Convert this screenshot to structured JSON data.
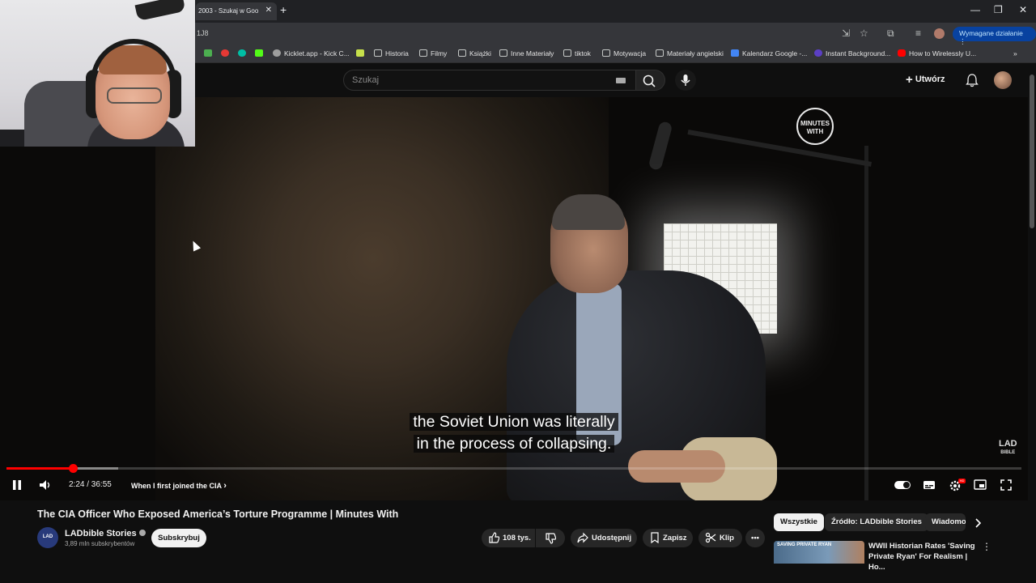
{
  "browser": {
    "tab_title": "2003 - Szukaj w Goo",
    "tab_close": "✕",
    "new_tab": "+",
    "url": "1J8",
    "required_action": "Wymagane działanie",
    "window_controls": [
      "—",
      "❐",
      "✕"
    ]
  },
  "bookmarks": [
    {
      "label": "",
      "icon": "green-app-icon",
      "color": "#4caf50"
    },
    {
      "label": "",
      "icon": "red-app-icon",
      "color": "#e53935"
    },
    {
      "label": "",
      "icon": "kick-icon",
      "color": "#53fc18"
    },
    {
      "label": "Kicklet.app - Kick C...",
      "icon": "kicklet-icon",
      "color": "#9e9e9e"
    },
    {
      "label": "",
      "icon": "x-app-icon",
      "color": "#c6e04b"
    },
    {
      "label": "Historia",
      "icon": "folder-icon",
      "color": ""
    },
    {
      "label": "Filmy",
      "icon": "folder-icon",
      "color": ""
    },
    {
      "label": "Książki",
      "icon": "folder-icon",
      "color": ""
    },
    {
      "label": "Inne Materiały",
      "icon": "folder-icon",
      "color": ""
    },
    {
      "label": "tiktok",
      "icon": "folder-icon",
      "color": ""
    },
    {
      "label": "Motywacja",
      "icon": "folder-icon",
      "color": ""
    },
    {
      "label": "Materiały angielski",
      "icon": "folder-icon",
      "color": ""
    },
    {
      "label": "Kalendarz Google -...",
      "icon": "calendar-icon",
      "color": "#4285f4"
    },
    {
      "label": "Instant Background...",
      "icon": "instant-bg-icon",
      "color": "#5b3fc4"
    },
    {
      "label": "How to Wirelessly U...",
      "icon": "youtube-icon",
      "color": "#ff0000"
    }
  ],
  "youtube": {
    "search_placeholder": "Szukaj",
    "create_label": "Utwórz"
  },
  "video": {
    "caption_line1": "the Soviet Union was literally",
    "caption_line2": "in the process of collapsing.",
    "overlay_logo_line1": "MINUTES",
    "overlay_logo_line2": "WITH",
    "corner_logo_line1": "LAD",
    "corner_logo_line2": "BIBLE",
    "time": "2:24 / 36:55",
    "chapter": "When I first joined the CIA",
    "progress_fraction": 0.065,
    "buffered_fraction": 0.11,
    "hd_badge": "HD"
  },
  "details": {
    "title": "The CIA Officer Who Exposed America’s Torture Programme | Minutes With",
    "channel_name": "LADbible Stories",
    "channel_avatar": "LAD",
    "subscribers": "3,89 mln subskrybentów",
    "subscribe_label": "Subskrybuj",
    "likes": "108 tys.",
    "share_label": "Udostępnij",
    "save_label": "Zapisz",
    "clip_label": "Klip"
  },
  "chips": [
    "Wszystkie",
    "Źródło: LADbible Stories",
    "Wiadomości"
  ],
  "recommendation": {
    "title": "WWII Historian Rates 'Saving Private Ryan' For Realism | Ho...",
    "thumb_text": "SAVING PRIVATE RYAN"
  }
}
